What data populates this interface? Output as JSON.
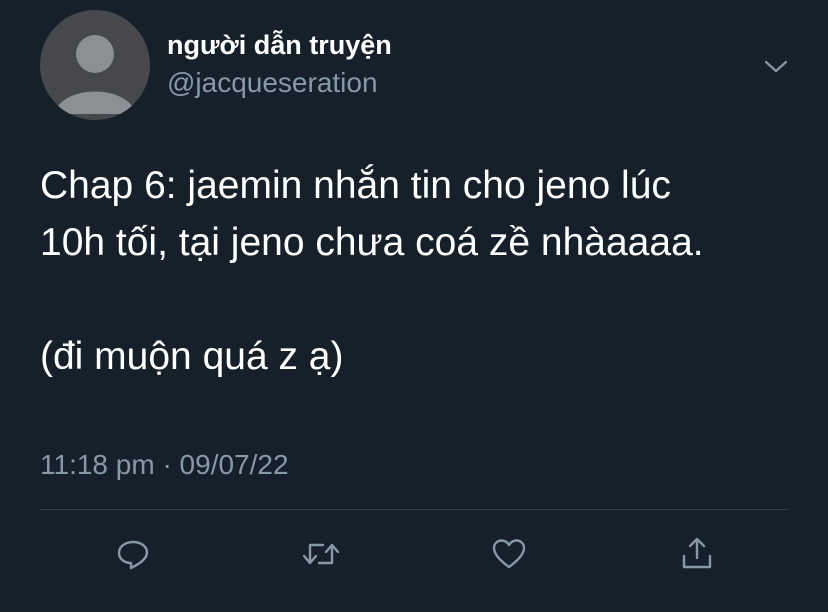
{
  "user": {
    "display_name": "người dẫn truyện",
    "handle": "@jacqueseration",
    "avatar_icon": "default-avatar-icon"
  },
  "tweet": {
    "lines": [
      "Chap 6: jaemin nhắn tin cho jeno lúc",
      "10h tối, tại jeno chưa coá zề nhàaaaa.",
      "(đi muộn quá z ạ)"
    ],
    "timestamp": "11:18 pm · 09/07/22"
  },
  "actions": [
    {
      "icon": "reply-icon"
    },
    {
      "icon": "retweet-icon"
    },
    {
      "icon": "like-icon"
    },
    {
      "icon": "share-icon"
    }
  ],
  "colors": {
    "background": "#15202b",
    "primary_text": "#ffffff",
    "secondary_text": "#8899a6",
    "divider": "#38444d"
  }
}
